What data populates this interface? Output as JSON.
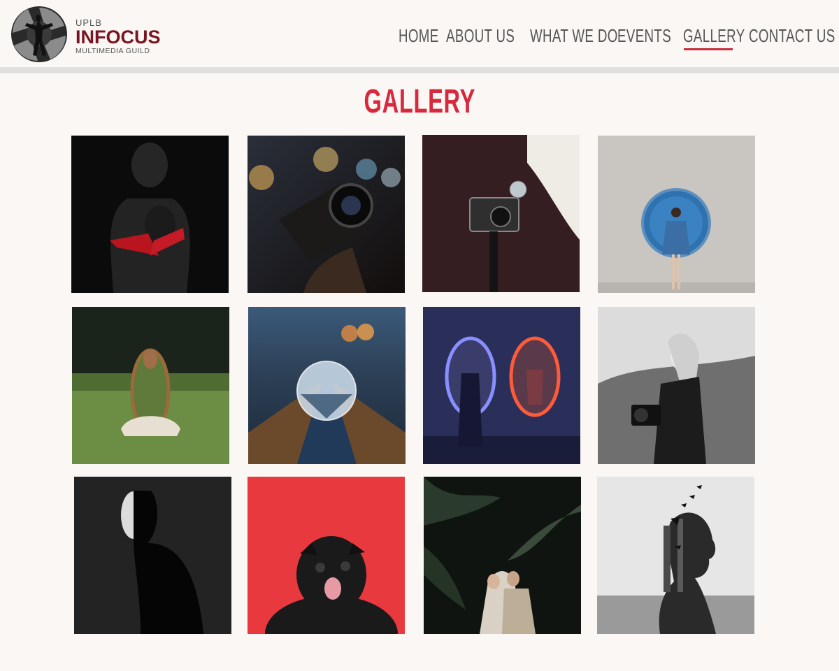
{
  "brand": {
    "line1": "UPLB",
    "line2": "INFOCUS",
    "line3": "MULTIMEDIA GUILD",
    "accent": "#7a1422"
  },
  "nav": {
    "items": [
      {
        "label": "HOME"
      },
      {
        "label": "ABOUT US"
      },
      {
        "label": "WHAT WE DO"
      },
      {
        "label": "EVENTS"
      },
      {
        "label": "GALLERY",
        "active": true
      },
      {
        "label": "CONTACT US"
      }
    ],
    "active_color": "#c92c3c"
  },
  "page": {
    "title": "GALLERY",
    "title_color": "#d8283d"
  },
  "gallery": {
    "photos": [
      {
        "subject": "dark-body-portrait-image"
      },
      {
        "subject": "hand-holding-camera-image"
      },
      {
        "subject": "vintage-camera-image"
      },
      {
        "subject": "woman-blue-circle-image"
      },
      {
        "subject": "woman-holding-mirror-image"
      },
      {
        "subject": "crystal-ball-road-image"
      },
      {
        "subject": "neon-mirror-portal-image"
      },
      {
        "subject": "woman-with-camera-image"
      },
      {
        "subject": "shadow-silhouette-image"
      },
      {
        "subject": "pug-red-background-image"
      },
      {
        "subject": "couple-in-ferns-image"
      },
      {
        "subject": "double-exposure-birds-image"
      }
    ]
  }
}
